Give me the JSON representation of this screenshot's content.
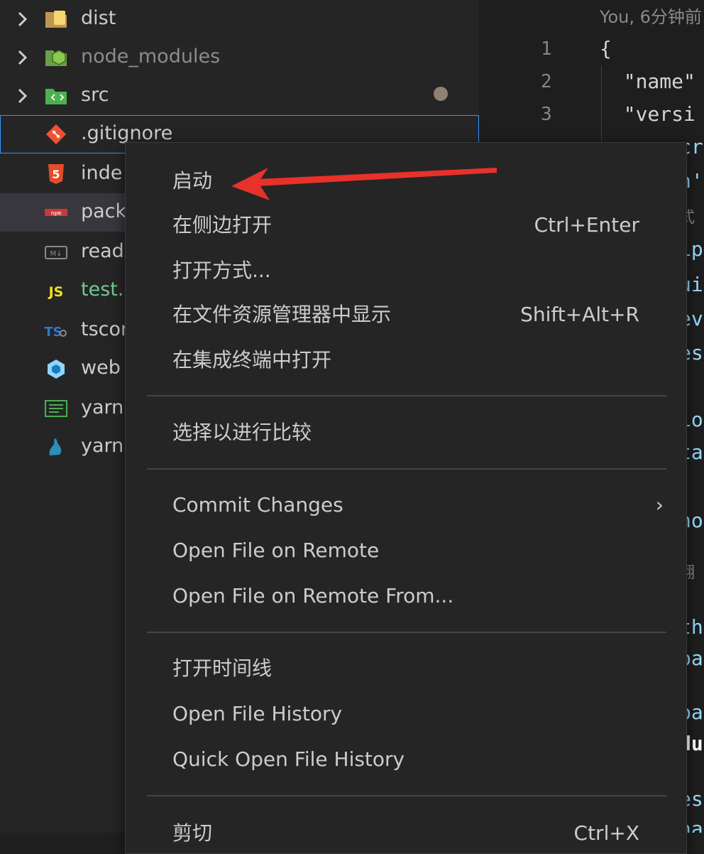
{
  "explorer": {
    "items": [
      {
        "label": "dist",
        "icon": "folder-dist-icon",
        "color": "#cccccc"
      },
      {
        "label": "node_modules",
        "icon": "folder-node-icon",
        "color": "#8c8c8c"
      },
      {
        "label": "src",
        "icon": "folder-src-icon",
        "color": "#cccccc"
      },
      {
        "label": ".gitignore",
        "icon": "git-icon",
        "color": "#cccccc"
      },
      {
        "label": "inde",
        "icon": "html5-icon",
        "color": "#cccccc"
      },
      {
        "label": "pack",
        "icon": "npm-icon",
        "color": "#cccccc"
      },
      {
        "label": "read",
        "icon": "markdown-icon",
        "color": "#cccccc"
      },
      {
        "label": "test.",
        "icon": "javascript-icon",
        "color": "#73c991"
      },
      {
        "label": "tscor",
        "icon": "typescript-config-icon",
        "color": "#cccccc"
      },
      {
        "label": "web",
        "icon": "webpack-icon",
        "color": "#cccccc"
      },
      {
        "label": "yarn",
        "icon": "yarn-log-icon",
        "color": "#cccccc"
      },
      {
        "label": "yarn",
        "icon": "yarn-icon",
        "color": "#cccccc"
      }
    ]
  },
  "editor": {
    "blame": "You, 6分钟前",
    "lines": [
      {
        "num": "1",
        "text": "{"
      },
      {
        "num": "2",
        "text": "  \"name\""
      },
      {
        "num": "3",
        "text": "  \"versi"
      }
    ],
    "fragments": [
      "cr",
      "n'",
      "式",
      "ip",
      "ui",
      "ev",
      "es",
      "io",
      "ta",
      "no",
      "翻",
      "th",
      "pa",
      "pa",
      "du",
      "es",
      "na"
    ]
  },
  "context_menu": {
    "groups": [
      [
        {
          "label": "启动",
          "shortcut": ""
        },
        {
          "label": "在侧边打开",
          "shortcut": "Ctrl+Enter"
        },
        {
          "label": "打开方式...",
          "shortcut": ""
        },
        {
          "label": "在文件资源管理器中显示",
          "shortcut": "Shift+Alt+R"
        },
        {
          "label": "在集成终端中打开",
          "shortcut": ""
        }
      ],
      [
        {
          "label": "选择以进行比较",
          "shortcut": ""
        }
      ],
      [
        {
          "label": "Commit Changes",
          "shortcut": "",
          "submenu": "›"
        },
        {
          "label": "Open File on Remote",
          "shortcut": ""
        },
        {
          "label": "Open File on Remote From...",
          "shortcut": ""
        }
      ],
      [
        {
          "label": "打开时间线",
          "shortcut": ""
        },
        {
          "label": "Open File History",
          "shortcut": ""
        },
        {
          "label": "Quick Open File History",
          "shortcut": ""
        }
      ],
      [
        {
          "label": "剪切",
          "shortcut": "Ctrl+X"
        }
      ]
    ]
  },
  "annotation": {
    "color": "#e8312a"
  },
  "colors": {
    "accent": "#3794ff",
    "background": "#252526",
    "modified_dot": "#8e8170"
  }
}
